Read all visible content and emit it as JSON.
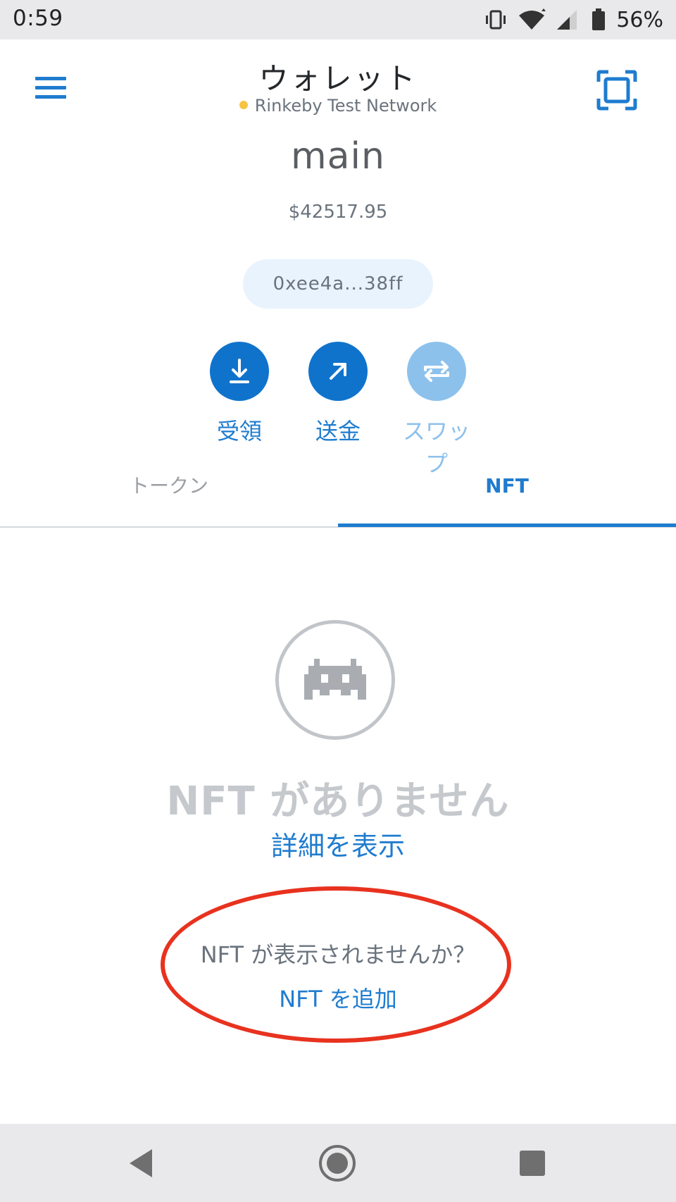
{
  "status_bar": {
    "time": "0:59",
    "battery_percent": "56%",
    "icons": [
      "vibrate-icon",
      "wifi-icon",
      "cell-signal-icon",
      "battery-icon"
    ]
  },
  "header": {
    "title": "ウォレット",
    "network": "Rinkeby Test Network",
    "network_dot_color": "#f6c343",
    "icons": [
      "hamburger-menu-icon",
      "qr-scan-icon"
    ]
  },
  "account": {
    "name": "main",
    "balance": "$42517.95",
    "address": "0xee4a...38ff"
  },
  "actions": {
    "receive_label": "受領",
    "send_label": "送金",
    "swap_label": "スワップ"
  },
  "tabs": {
    "tokens": "トークン",
    "nft": "NFT",
    "active": "NFT"
  },
  "empty_state": {
    "title": "NFT がありません",
    "learn_more": "詳細を表示",
    "not_showing": "NFT が表示されませんか？",
    "add_nft": "NFT を追加",
    "icon": "space-invader-icon"
  },
  "colors": {
    "accent": "#1f7ccf",
    "annotation": "#e8321f"
  },
  "nav_bar": {
    "icons": [
      "back-icon",
      "home-icon",
      "recents-icon"
    ]
  }
}
